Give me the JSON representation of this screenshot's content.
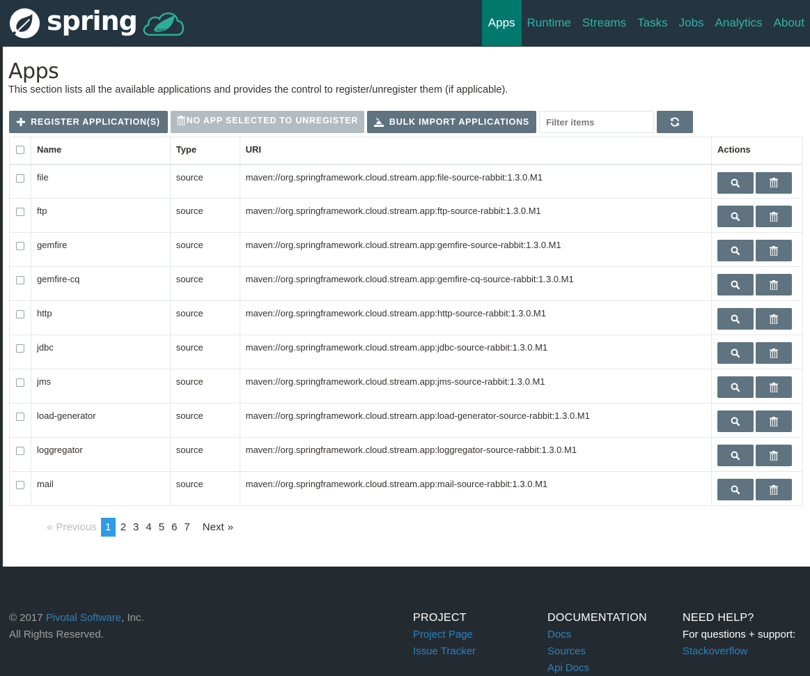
{
  "header": {
    "brand_text": "spring",
    "nav": [
      {
        "label": "Apps",
        "active": true
      },
      {
        "label": "Runtime",
        "active": false
      },
      {
        "label": "Streams",
        "active": false
      },
      {
        "label": "Tasks",
        "active": false
      },
      {
        "label": "Jobs",
        "active": false
      },
      {
        "label": "Analytics",
        "active": false
      },
      {
        "label": "About",
        "active": false
      }
    ]
  },
  "page": {
    "title": "Apps",
    "description": "This section lists all the available applications and provides the control to register/unregister them (if applicable)."
  },
  "toolbar": {
    "register_label": "Register Application(s)",
    "unregister_label": "No App selected to unregister",
    "bulk_import_label": "Bulk Import Applications",
    "filter_placeholder": "Filter items",
    "filter_value": ""
  },
  "table": {
    "headers": {
      "name": "Name",
      "type": "Type",
      "uri": "URI",
      "actions": "Actions"
    },
    "rows": [
      {
        "name": "file",
        "type": "source",
        "uri": "maven://org.springframework.cloud.stream.app:file-source-rabbit:1.3.0.M1"
      },
      {
        "name": "ftp",
        "type": "source",
        "uri": "maven://org.springframework.cloud.stream.app:ftp-source-rabbit:1.3.0.M1"
      },
      {
        "name": "gemfire",
        "type": "source",
        "uri": "maven://org.springframework.cloud.stream.app:gemfire-source-rabbit:1.3.0.M1"
      },
      {
        "name": "gemfire-cq",
        "type": "source",
        "uri": "maven://org.springframework.cloud.stream.app:gemfire-cq-source-rabbit:1.3.0.M1"
      },
      {
        "name": "http",
        "type": "source",
        "uri": "maven://org.springframework.cloud.stream.app:http-source-rabbit:1.3.0.M1"
      },
      {
        "name": "jdbc",
        "type": "source",
        "uri": "maven://org.springframework.cloud.stream.app:jdbc-source-rabbit:1.3.0.M1"
      },
      {
        "name": "jms",
        "type": "source",
        "uri": "maven://org.springframework.cloud.stream.app:jms-source-rabbit:1.3.0.M1"
      },
      {
        "name": "load-generator",
        "type": "source",
        "uri": "maven://org.springframework.cloud.stream.app:load-generator-source-rabbit:1.3.0.M1"
      },
      {
        "name": "loggregator",
        "type": "source",
        "uri": "maven://org.springframework.cloud.stream.app:loggregator-source-rabbit:1.3.0.M1"
      },
      {
        "name": "mail",
        "type": "source",
        "uri": "maven://org.springframework.cloud.stream.app:mail-source-rabbit:1.3.0.M1"
      }
    ]
  },
  "pagination": {
    "prev_symbol": "«",
    "prev_label": "Previous",
    "next_label": "Next",
    "next_symbol": "»",
    "current": 1,
    "pages": [
      "1",
      "2",
      "3",
      "4",
      "5",
      "6",
      "7"
    ]
  },
  "footer": {
    "copyright_prefix": "© 2017 ",
    "company_link": "Pivotal Software",
    "copyright_suffix": ", Inc.",
    "rights": "All Rights Reserved.",
    "project": {
      "heading": "PROJECT",
      "links": [
        "Project Page",
        "Issue Tracker"
      ]
    },
    "documentation": {
      "heading": "DOCUMENTATION",
      "links": [
        "Docs",
        "Sources",
        "Api Docs"
      ]
    },
    "help": {
      "heading": "NEED HELP?",
      "text": "For questions + support:",
      "links": [
        "Stackoverflow"
      ]
    }
  },
  "colors": {
    "navbar_bg": "#243441",
    "nav_active_bg": "#00786c",
    "nav_link": "#2cb5a4",
    "button_bg": "#5f7380",
    "button_disabled_bg": "#b2bcc2",
    "pager_active": "#2e9be6",
    "footer_bg": "#242b30",
    "footer_link": "#2b81bf"
  }
}
